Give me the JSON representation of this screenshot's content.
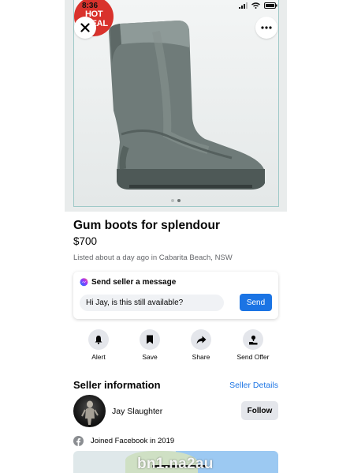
{
  "status_bar": {
    "time": "8:36"
  },
  "hero": {
    "watermark_logo_text": "HOT DEAL",
    "page_dots": 2,
    "active_dot": 0
  },
  "listing": {
    "title": "Gum boots for splendour",
    "price": "$700",
    "listed": "Listed about a day ago in Cabarita Beach, NSW"
  },
  "message": {
    "heading": "Send seller a message",
    "input_value": "Hi Jay, is this still available?",
    "send_label": "Send"
  },
  "actions": [
    {
      "label": "Alert",
      "icon": "bell-icon"
    },
    {
      "label": "Save",
      "icon": "bookmark-icon"
    },
    {
      "label": "Share",
      "icon": "share-icon"
    },
    {
      "label": "Send Offer",
      "icon": "send-offer-icon"
    }
  ],
  "seller": {
    "heading": "Seller information",
    "details_link": "Seller Details",
    "name": "Jay Slaughter",
    "follow_label": "Follow",
    "joined": "Joined Facebook in 2019"
  },
  "watermark": "bn1.na2au",
  "colors": {
    "accent": "#1b74e4",
    "messenger": "#a334fa"
  }
}
